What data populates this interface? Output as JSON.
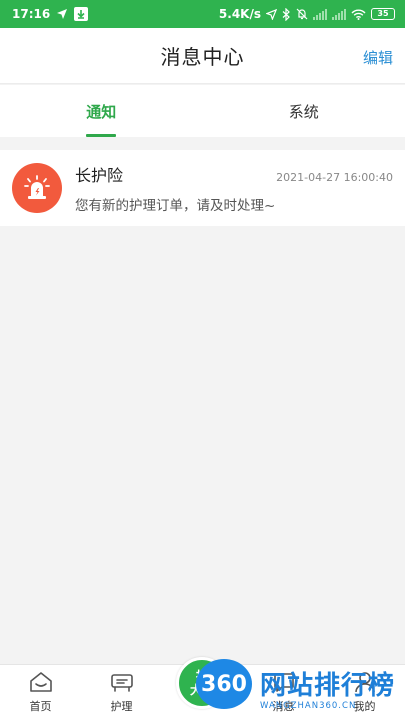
{
  "status_bar": {
    "time": "17:16",
    "network_speed": "5.4K/s",
    "battery": "35",
    "icons": [
      "navigation-icon",
      "download-icon",
      "location-icon",
      "bluetooth-icon",
      "mute-bell-icon",
      "signal-icon",
      "wifi-icon",
      "battery-icon"
    ]
  },
  "header": {
    "title": "消息中心",
    "edit_label": "编辑"
  },
  "tabs": [
    {
      "label": "通知",
      "active": true
    },
    {
      "label": "系统",
      "active": false
    }
  ],
  "messages": [
    {
      "title": "长护险",
      "time": "2021-04-27 16:00:40",
      "text": "您有新的护理订单，请及时处理~",
      "icon": "alarm-light-icon"
    }
  ],
  "bottom_nav": {
    "items": [
      {
        "label": "首页",
        "icon": "home-icon"
      },
      {
        "label": "护理",
        "icon": "care-icon"
      },
      {
        "label": "消息",
        "icon": "message-icon"
      },
      {
        "label": "我的",
        "icon": "user-icon"
      }
    ],
    "center_button": {
      "line1": "抢",
      "line2": "大厅"
    }
  },
  "watermark": {
    "logo_text": "360",
    "text": "网站排行榜",
    "sub": "WANGZHAN360.CN"
  },
  "colors": {
    "primary": "#2fb34f",
    "tab_active": "#2fa84b",
    "edit": "#2b8fd4",
    "avatar_bg": "#f25a3d"
  }
}
